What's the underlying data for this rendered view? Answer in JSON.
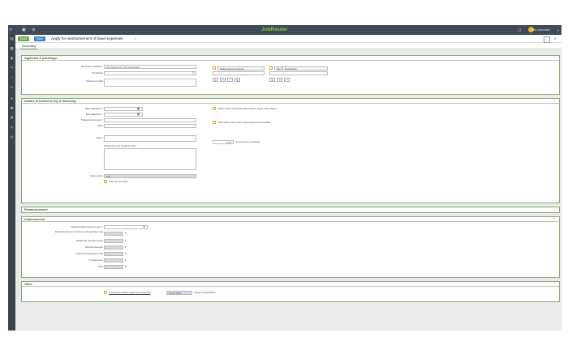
{
  "app": {
    "brand": "JobRouter",
    "user_name": "Max Neumann",
    "brand_color": "#8cc63f"
  },
  "toolbar": {
    "send_label": "Send",
    "save_label": "Save",
    "title": "Apply for reimbursement of travel expenses"
  },
  "tabs": [
    {
      "label": "Accounting"
    }
  ],
  "applicant": {
    "section_title": "Applicant & passenger",
    "business_traveller_label": "Business traveller *",
    "business_traveller_value": "Kiro Neumann (Kiro.Neumann)",
    "templates_label": "Templates",
    "discount_cards_label": "Discount cards",
    "discount_cards_value": "...",
    "passenger_header": "Passenger/companion",
    "file_header": "File",
    "description_header": "Description",
    "stepper1_value": "1",
    "stepper2_value": "1"
  },
  "details": {
    "section_title": "Details of business trip & financing",
    "start_label": "Start date/time *",
    "end_label": "End date/time *",
    "target_label": "Targets/customers *",
    "role_label": "Role",
    "type_label": "Type *",
    "type_value": "...",
    "purpose_label": "Purpose of the business trip *",
    "cost_center_label": "Cost center",
    "cost_center_value": "100",
    "save_template": "Save as template",
    "temporal_text": "There was a temporal link between leave and mission",
    "third_party_text": "Third-party funds were used (grants or benefits)",
    "advance_value": "0,00",
    "advance_text": "€ received in advance"
  },
  "reimbursement": {
    "section_title": "Reimbursement"
  },
  "disbursement": {
    "section_title": "Disbursement",
    "desired_label": "Desired disbursement type *",
    "rows": [
      {
        "label": "Reimbursement of travel costs (private car)",
        "currency": "€"
      },
      {
        "label": "Additional catering costs",
        "currency": "€"
      },
      {
        "label": "Reimbursement",
        "currency": "€"
      },
      {
        "label": "- Grants Third-party funds",
        "currency": "€"
      },
      {
        "label": "- Prepayment",
        "currency": "€"
      },
      {
        "label": "Total",
        "currency": "€"
      }
    ]
  },
  "other": {
    "section_title": "Other",
    "compliance_text": "Corporate policies read and accepted",
    "date_value": "24.01.2019",
    "date_label": "Date of application"
  }
}
